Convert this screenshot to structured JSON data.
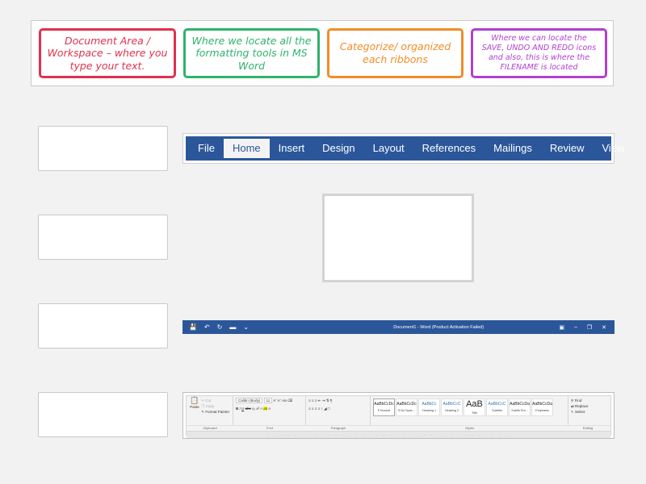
{
  "answer_cards": [
    {
      "text": "Document Area / Workspace – where you type your text.",
      "color": "#e0314f"
    },
    {
      "text": "Where we locate all the formatting tools in MS Word",
      "color": "#2fb36b"
    },
    {
      "text": "Categorize/ organized each ribbons",
      "color": "#f28c28"
    },
    {
      "text": "Where we can locate the SAVE, UNDO AND REDO icons and also, this is where the FILENAME is located",
      "color": "#b23fcf"
    }
  ],
  "tabs": [
    "File",
    "Home",
    "Insert",
    "Design",
    "Layout",
    "References",
    "Mailings",
    "Review",
    "View"
  ],
  "active_tab": "Home",
  "title_bar": {
    "title": "Document1 - Word (Product Activation Failed)"
  },
  "ribbon": {
    "clipboard": {
      "paste": "Paste",
      "cut": "Cut",
      "copy": "Copy",
      "format_painter": "Format Painter",
      "label": "Clipboard"
    },
    "font": {
      "family": "Calibri (Body)",
      "size": "11",
      "label": "Font"
    },
    "paragraph": {
      "label": "Paragraph"
    },
    "styles": {
      "label": "Styles",
      "items": [
        {
          "sample": "AaBbCcDc",
          "name": "¶ Normal"
        },
        {
          "sample": "AaBbCcDc",
          "name": "¶ No Spac..."
        },
        {
          "sample": "AaBbCc",
          "name": "Heading 1"
        },
        {
          "sample": "AaBbCcC",
          "name": "Heading 2"
        },
        {
          "sample": "AaB",
          "name": "Title"
        },
        {
          "sample": "AaBbCcC",
          "name": "Subtitle"
        },
        {
          "sample": "AaBbCcDa",
          "name": "Subtle Em..."
        },
        {
          "sample": "AaBbCcDa",
          "name": "Emphasis"
        }
      ]
    },
    "editing": {
      "find": "Find",
      "replace": "Replace",
      "select": "Select",
      "label": "Editing"
    }
  },
  "colors": {
    "word_blue": "#2b579a"
  }
}
